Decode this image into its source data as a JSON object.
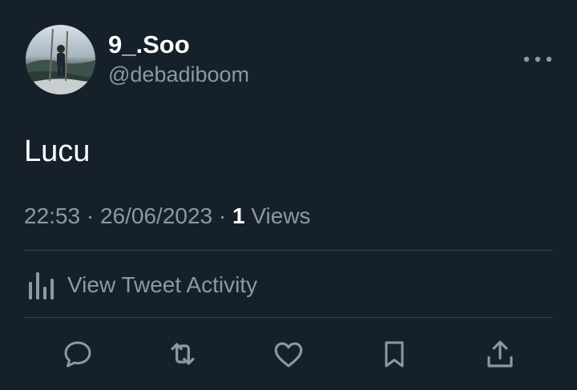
{
  "author": {
    "display_name": "9_.Soo",
    "handle": "@debadiboom"
  },
  "tweet": {
    "text": "Lucu",
    "time": "22:53",
    "separator": "·",
    "date": "26/06/2023",
    "views_count": "1",
    "views_label": "Views"
  },
  "activity": {
    "label": "View Tweet Activity"
  },
  "icons": {
    "more": "more-horizontal-icon",
    "activity": "bar-chart-icon",
    "reply": "reply-icon",
    "retweet": "retweet-icon",
    "like": "heart-icon",
    "bookmark": "bookmark-icon",
    "share": "share-icon"
  },
  "colors": {
    "background": "#15202b",
    "secondary_text": "#8b98a5",
    "divider": "#38444d",
    "primary_text": "#ffffff"
  }
}
